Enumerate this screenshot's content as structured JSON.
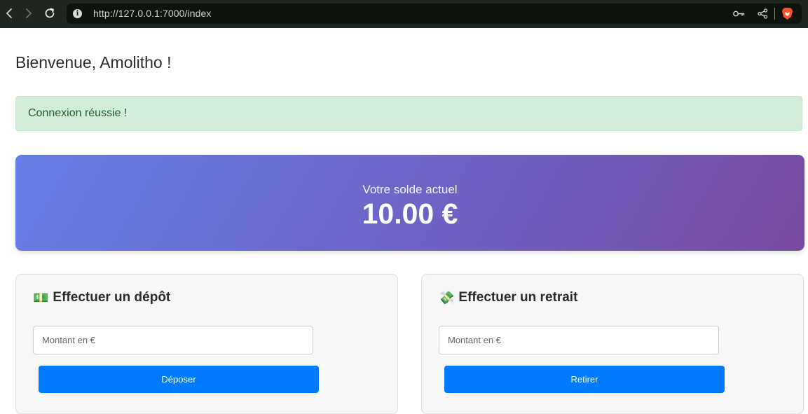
{
  "browser": {
    "url": "http://127.0.0.1:7000/index",
    "icons": [
      "back-icon",
      "forward-icon",
      "reload-icon",
      "site-info-icon",
      "key-icon",
      "share-icon",
      "brave-lion-icon"
    ]
  },
  "page": {
    "greeting": "Bienvenue, Amolitho !",
    "alert": "Connexion réussie !",
    "balance": {
      "label": "Votre solde actuel",
      "amount": "10.00 €"
    },
    "deposit": {
      "emoji": "💵",
      "title": "Effectuer un dépôt",
      "placeholder": "Montant en €",
      "button": "Déposer"
    },
    "withdraw": {
      "emoji": "💸",
      "title": "Effectuer un retrait",
      "placeholder": "Montant en €",
      "button": "Retirer"
    }
  },
  "colors": {
    "toolbar": "#1f261f",
    "alert_bg": "#d4ecda",
    "gradient_start": "#667eea",
    "gradient_end": "#764ba2",
    "button": "#007bff"
  }
}
